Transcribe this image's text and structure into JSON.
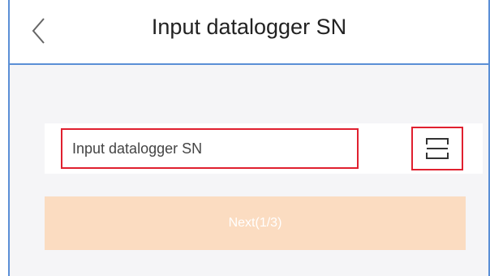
{
  "header": {
    "title": "Input datalogger SN",
    "back_icon": "chevron-left-icon"
  },
  "form": {
    "sn_input": {
      "placeholder": "Input datalogger SN",
      "value": ""
    },
    "scan_icon": "scan-frame-icon"
  },
  "actions": {
    "next_label": "Next(1/3)"
  },
  "colors": {
    "next_button_bg": "#fbdcc1",
    "highlight_border": "#e0202f",
    "frame_border": "#5b8fd6"
  }
}
